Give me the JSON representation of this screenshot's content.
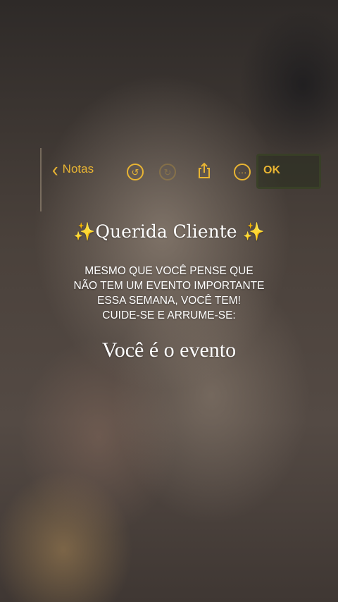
{
  "toolbar": {
    "back_label": "Notas",
    "done_label": "OK",
    "icons": [
      "chevron-left-icon",
      "undo-icon",
      "redo-icon",
      "share-icon",
      "more-icon"
    ],
    "accent_color": "#e8b433"
  },
  "note": {
    "title_left_sparkle": "✨",
    "title": "Querida Cliente",
    "title_right_sparkle": "✨",
    "message_lines": [
      "MESMO QUE VOCÊ PENSE QUE",
      "NÃO TEM UM EVENTO IMPORTANTE",
      "ESSA SEMANA, VOCÊ TEM!",
      "CUIDE-SE E ARRUME-SE:"
    ],
    "tagline": "Você é o evento"
  }
}
